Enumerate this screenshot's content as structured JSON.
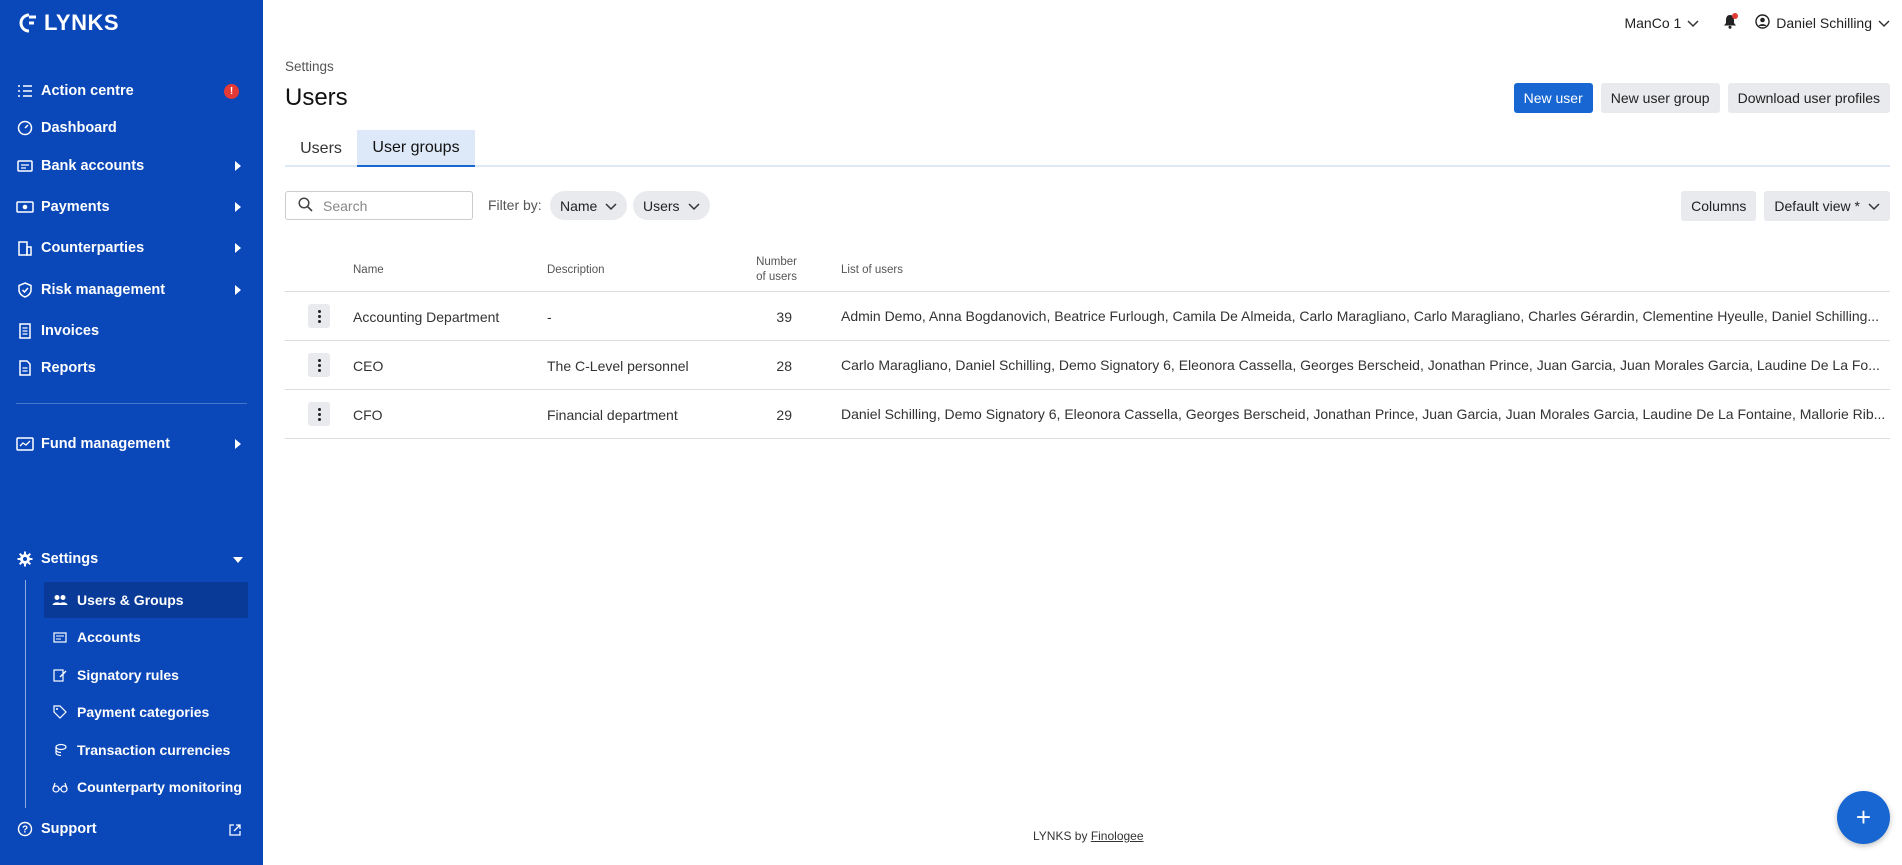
{
  "app": {
    "logo_text": "LYNKS"
  },
  "sidebar": {
    "items": [
      {
        "label": "Action centre",
        "icon": "list-check-icon",
        "badge": "!"
      },
      {
        "label": "Dashboard",
        "icon": "gauge-icon"
      },
      {
        "label": "Bank accounts",
        "icon": "card-icon"
      },
      {
        "label": "Payments",
        "icon": "cash-icon"
      },
      {
        "label": "Counterparties",
        "icon": "building-icon"
      },
      {
        "label": "Risk management",
        "icon": "shield-icon"
      },
      {
        "label": "Invoices",
        "icon": "receipt-icon"
      },
      {
        "label": "Reports",
        "icon": "document-icon"
      },
      {
        "label": "Fund management",
        "icon": "fund-icon"
      },
      {
        "label": "Settings",
        "icon": "gear-icon"
      }
    ],
    "settings_sub": [
      {
        "label": "Users & Groups",
        "icon": "users-icon"
      },
      {
        "label": "Accounts",
        "icon": "id-card-icon"
      },
      {
        "label": "Signatory rules",
        "icon": "signature-icon"
      },
      {
        "label": "Payment categories",
        "icon": "tag-icon"
      },
      {
        "label": "Transaction currencies",
        "icon": "coins-icon"
      },
      {
        "label": "Counterparty monitoring",
        "icon": "glasses-icon"
      }
    ],
    "support": {
      "label": "Support",
      "icon": "help-icon"
    }
  },
  "topbar": {
    "org": "ManCo 1",
    "user": "Daniel Schilling"
  },
  "page": {
    "breadcrumb": "Settings",
    "title": "Users",
    "actions": {
      "new_user": "New user",
      "new_user_group": "New user group",
      "download": "Download user profiles"
    },
    "tabs": [
      "Users",
      "User groups"
    ],
    "search_placeholder": "Search",
    "filter_label": "Filter by:",
    "filter_chips": [
      "Name",
      "Users"
    ],
    "columns_btn": "Columns",
    "view_btn": "Default view *"
  },
  "table": {
    "headers": {
      "name": "Name",
      "description": "Description",
      "number_l1": "Number",
      "number_l2": "of users",
      "list": "List of users"
    },
    "rows": [
      {
        "name": "Accounting Department",
        "description": "-",
        "count": "39",
        "users": "Admin Demo, Anna Bogdanovich, Beatrice Furlough, Camila De Almeida, Carlo Maragliano, Carlo Maragliano, Charles Gérardin, Clementine Hyeulle, Daniel Schilling..."
      },
      {
        "name": "CEO",
        "description": "The C-Level personnel",
        "count": "28",
        "users": "Carlo Maragliano, Daniel Schilling, Demo Signatory 6, Eleonora Cassella, Georges Berscheid, Jonathan Prince, Juan Garcia, Juan Morales Garcia, Laudine De La Fo..."
      },
      {
        "name": "CFO",
        "description": "Financial department",
        "count": "29",
        "users": "Daniel Schilling, Demo Signatory 6, Eleonora Cassella, Georges Berscheid, Jonathan Prince, Juan Garcia, Juan Morales Garcia, Laudine De La Fontaine, Mallorie Rib..."
      }
    ]
  },
  "footer": {
    "prefix": "LYNKS by ",
    "link": "Finologee"
  },
  "fab": {
    "label": "+"
  }
}
